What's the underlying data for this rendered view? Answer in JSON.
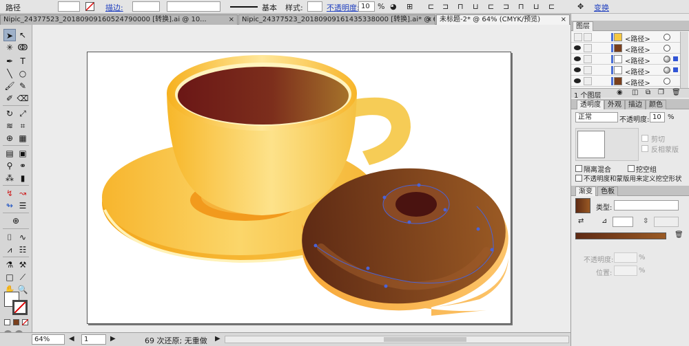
{
  "control_bar": {
    "selection_label": "路径",
    "stroke_label": "描边:",
    "stroke_profile": "基本",
    "style_label": "样式:",
    "opacity_label": "不透明度:",
    "opacity_value": "10",
    "opacity_unit": "%",
    "transform_label": "变换"
  },
  "tabs": [
    {
      "label": "Nipic_24377523_20180909160524790000   [转换].ai @ 10..."
    },
    {
      "label": "Nipic_24377523_20180909161435338000   [转换].ai* @ 6..."
    },
    {
      "label": "未标题-2* @ 64% (CMYK/预览)"
    }
  ],
  "tab_close": "×",
  "layers_panel": {
    "title": "图层",
    "rows": [
      {
        "name": "<路径>"
      },
      {
        "name": "<路径>"
      },
      {
        "name": "<路径>"
      },
      {
        "name": "<路径>"
      },
      {
        "name": "<路径>"
      }
    ],
    "count": "1 个图层"
  },
  "transparency_panel": {
    "tabs": [
      "透明度",
      "外观",
      "描边",
      "颜色"
    ],
    "blend_mode": "正常",
    "opacity_label": "不透明度:",
    "opacity_value": "10",
    "opacity_unit": "%",
    "clip_label": "剪切",
    "invert_mask_label": "反相蒙版",
    "isolate_blend_label": "隔离混合",
    "knockout_group_label": "挖空组",
    "define_knockout_label": "不透明度和蒙版用来定义挖空形状"
  },
  "gradient_panel": {
    "tabs": [
      "渐变",
      "色板"
    ],
    "type_label": "类型:",
    "opacity_label": "不透明度:",
    "location_label": "位置:",
    "percent": "%"
  },
  "status_bar": {
    "zoom": "64%",
    "artboard_num": "1",
    "undo_text": "69 次还原; 无重做"
  },
  "colors": {
    "cup_yellow": "#f5c842",
    "coffee_dark": "#6e1b16",
    "donut_brown": "#7a3f1c",
    "selection_blue": "#4b63d6"
  }
}
